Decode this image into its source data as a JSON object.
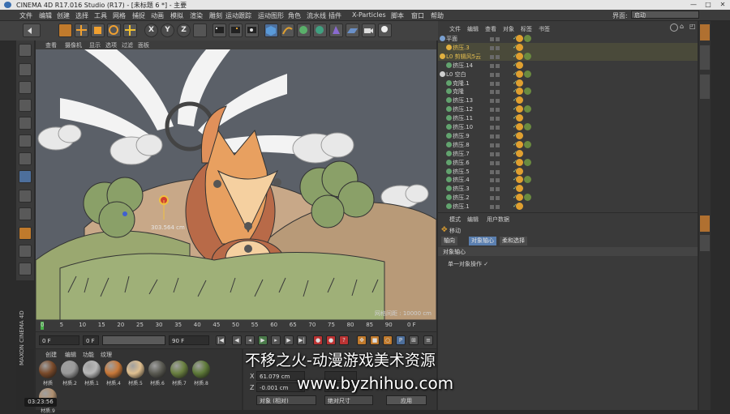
{
  "window": {
    "title": "CINEMA 4D R17.016 Studio (R17) - [未标题 6 *] - 主要"
  },
  "menubar": {
    "items": [
      "文件",
      "编辑",
      "创建",
      "选择",
      "工具",
      "网格",
      "捕捉",
      "动画",
      "模拟",
      "渲染",
      "雕刻",
      "运动跟踪",
      "运动图形",
      "角色",
      "流水线",
      "插件",
      "X-Particles",
      "脚本",
      "窗口",
      "帮助"
    ],
    "layout_label": "界面:",
    "layout_value": "启动"
  },
  "viewport": {
    "menu": [
      "查看",
      "摄像机",
      "显示",
      "选项",
      "过滤",
      "面板"
    ],
    "grid_spacing": "网格间距 : 10000 cm",
    "measure": "303.564 cm"
  },
  "timeline": {
    "ticks": [
      "0",
      "5",
      "10",
      "15",
      "20",
      "25",
      "30",
      "35",
      "40",
      "45",
      "50",
      "55",
      "60",
      "65",
      "70",
      "75",
      "80",
      "85",
      "90"
    ],
    "end_frame": "0 F"
  },
  "anim": {
    "current_frame": "0 F",
    "start_frame": "0 F",
    "end_frame": "90 F",
    "range_end": "90 F"
  },
  "materials": {
    "menu": [
      "创建",
      "编辑",
      "功能",
      "纹理"
    ],
    "items": [
      {
        "label": "材质",
        "color": "#7a4a2a"
      },
      {
        "label": "材质.2",
        "color": "#9a9a9a"
      },
      {
        "label": "材质.1",
        "color": "#b8b8b8"
      },
      {
        "label": "材质.4",
        "color": "#c87838"
      },
      {
        "label": "材质.5",
        "color": "#e0c090"
      },
      {
        "label": "材质.6",
        "color": "#5a5a52"
      },
      {
        "label": "材质.7",
        "color": "#6a8040"
      },
      {
        "label": "材质.8",
        "color": "#5e7a38"
      },
      {
        "label": "材质.9",
        "color": "#b09070"
      }
    ]
  },
  "coords": {
    "x_value": "61.079 cm",
    "z_value": "-0.001 cm",
    "dropdown1": "对象 (相对)",
    "dropdown2": "绝对尺寸",
    "apply": "应用"
  },
  "object_manager": {
    "menu": [
      "文件",
      "编辑",
      "查看",
      "对象",
      "标签",
      "书签"
    ],
    "rows": [
      {
        "name": "平面",
        "indent": 8,
        "color": "#7aa0d0"
      },
      {
        "name": "挤压.3",
        "indent": 16,
        "color": "#e0b040",
        "highlight": true
      },
      {
        "name": "L0 剪辑风5云",
        "indent": 8,
        "color": "#e0b040",
        "highlight": true
      },
      {
        "name": "挤压.14",
        "indent": 16,
        "color": "#62a36e"
      },
      {
        "name": "L0 空白",
        "indent": 8,
        "color": "#cfcfcf"
      },
      {
        "name": "克隆.1",
        "indent": 16,
        "color": "#62a36e"
      },
      {
        "name": "克隆",
        "indent": 16,
        "color": "#62a36e"
      },
      {
        "name": "挤压.13",
        "indent": 16,
        "color": "#62a36e"
      },
      {
        "name": "挤压.12",
        "indent": 16,
        "color": "#62a36e"
      },
      {
        "name": "挤压.11",
        "indent": 16,
        "color": "#62a36e"
      },
      {
        "name": "挤压.10",
        "indent": 16,
        "color": "#62a36e"
      },
      {
        "name": "挤压.9",
        "indent": 16,
        "color": "#62a36e"
      },
      {
        "name": "挤压.8",
        "indent": 16,
        "color": "#62a36e"
      },
      {
        "name": "挤压.7",
        "indent": 16,
        "color": "#62a36e"
      },
      {
        "name": "挤压.6",
        "indent": 16,
        "color": "#62a36e"
      },
      {
        "name": "挤压.5",
        "indent": 16,
        "color": "#62a36e"
      },
      {
        "name": "挤压.4",
        "indent": 16,
        "color": "#62a36e"
      },
      {
        "name": "挤压.3",
        "indent": 16,
        "color": "#62a36e"
      },
      {
        "name": "挤压.2",
        "indent": 16,
        "color": "#62a36e"
      },
      {
        "name": "挤压.1",
        "indent": 16,
        "color": "#62a36e"
      }
    ]
  },
  "attribute_manager": {
    "menu": [
      "模式",
      "编辑",
      "用户数据"
    ],
    "mode_label": "移动",
    "tabs": [
      "轴向",
      "对象轴心",
      "柔和选择"
    ],
    "active_tab": "对象轴心",
    "section_title": "对象轴心",
    "option": "单一对象操作 ✓"
  },
  "overlay": {
    "timer": "03:23:56",
    "watermark_line1": "不移之火-动漫游戏美术资源",
    "watermark_line2": "www.byzhihuo.com"
  }
}
